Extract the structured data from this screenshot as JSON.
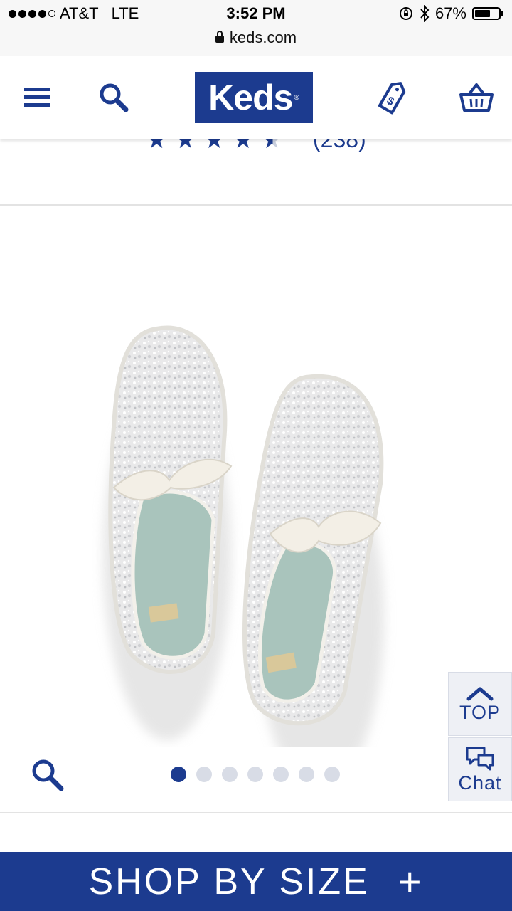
{
  "status_bar": {
    "carrier": "AT&T",
    "network": "LTE",
    "time": "3:52 PM",
    "battery": "67%",
    "battery_level": 0.67,
    "signal_bars": 4,
    "url": "keds.com"
  },
  "header": {
    "logo_text": "Keds",
    "icons": [
      "menu-icon",
      "search-icon",
      "price-tag-icon",
      "basket-icon"
    ]
  },
  "reviews": {
    "rating": 4.5,
    "count_label": "(238)"
  },
  "product": {
    "image_alt": "Glitter sneakers with satin ribbon laces",
    "carousel_total": 7,
    "carousel_active": 1
  },
  "side_buttons": {
    "top_label": "TOP",
    "chat_label": "Chat"
  },
  "shop_by_size": {
    "label": "SHOP BY SIZE",
    "toggle": "+"
  },
  "colors": {
    "brand_blue": "#1c3b8f",
    "inactive_dot": "#d8dce6"
  }
}
